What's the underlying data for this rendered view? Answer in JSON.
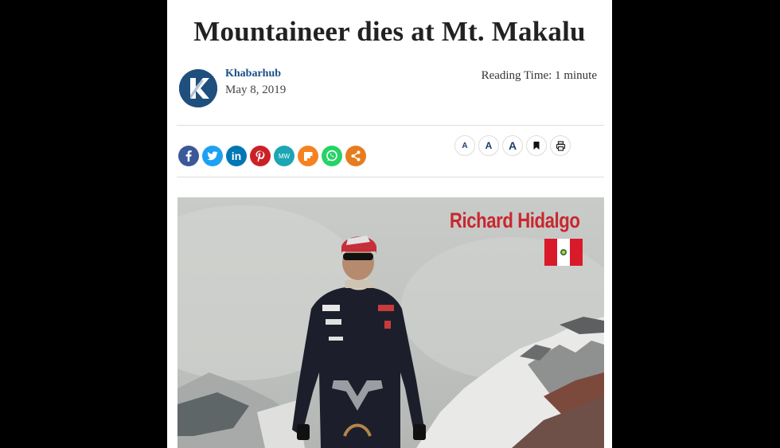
{
  "article": {
    "title": "Mountaineer dies at Mt. Makalu",
    "author": "Khabarhub",
    "date": "May 8, 2019",
    "reading_time": "Reading Time: 1 minute"
  },
  "share_buttons": [
    {
      "name": "facebook",
      "glyph": "f",
      "color": "#3b5998"
    },
    {
      "name": "twitter",
      "glyph": "t",
      "color": "#1da1f2"
    },
    {
      "name": "linkedin",
      "glyph": "in",
      "color": "#0077b5"
    },
    {
      "name": "pinterest",
      "glyph": "P",
      "color": "#cb2027"
    },
    {
      "name": "mewe",
      "glyph": "MW",
      "color": "#1ba6b5"
    },
    {
      "name": "mix",
      "glyph": "m",
      "color": "#f58220"
    },
    {
      "name": "whatsapp",
      "glyph": "w",
      "color": "#25d366"
    },
    {
      "name": "share",
      "glyph": "<",
      "color": "#e57d20"
    }
  ],
  "tools": {
    "font_small": "A",
    "font_medium": "A",
    "font_large": "A",
    "bookmark": "bookmark-icon",
    "print": "print-icon"
  },
  "photo": {
    "caption": "Richard Hidalgo",
    "flag": "peru-flag-icon"
  },
  "colors": {
    "page_background": "#000000",
    "article_background": "#ffffff",
    "author_link": "#1b4f86",
    "caption_red": "#c8272f"
  }
}
